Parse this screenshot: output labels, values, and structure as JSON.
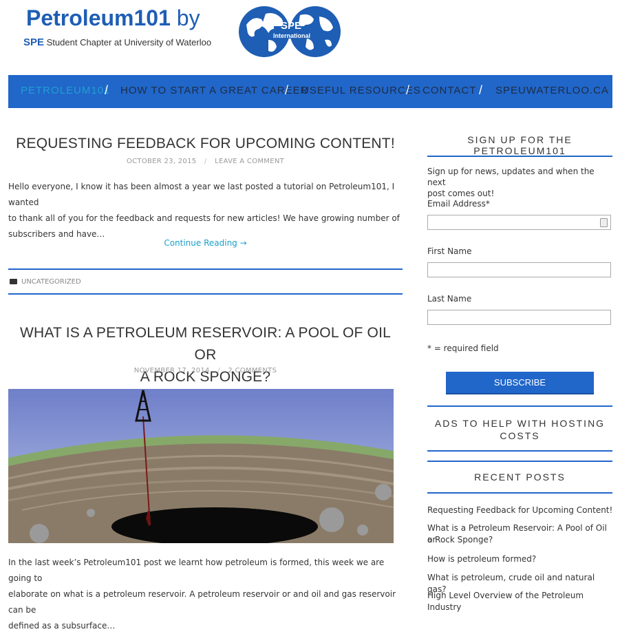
{
  "header": {
    "title": "Petroleum101",
    "title_by": "by",
    "sub_prefix": "SPE",
    "sub_text": "Student Chapter at University of Waterloo",
    "globe_line1": "SPE",
    "globe_line2": "International"
  },
  "nav": {
    "items": [
      "PETROLEUM101",
      "HOW TO START A GREAT CAREER",
      "USEFUL RESOURCES",
      "CONTACT",
      "SPEUWATERLOO.CA"
    ],
    "separator": "/"
  },
  "posts": [
    {
      "title": "REQUESTING FEEDBACK FOR UPCOMING CONTENT!",
      "date": "OCTOBER 23, 2015",
      "meta_sep": "/",
      "comments": "LEAVE A COMMENT",
      "excerpt_lines": [
        "Hello everyone, I know it has been almost a year we last posted a tutorial on Petroleum101, I wanted",
        "to thank all of you for the feedback and requests for new articles!  We have growing number of",
        "subscribers and have…"
      ],
      "more": "Continue Reading →",
      "category": "UNCATEGORIZED"
    },
    {
      "title_lines": [
        "WHAT IS A PETROLEUM RESERVOIR: A POOL OF OIL OR",
        "A ROCK SPONGE?"
      ],
      "date": "NOVEMBER 17, 2014",
      "meta_sep": "/",
      "comments": "2 COMMENTS",
      "excerpt_lines": [
        "In the last week’s Petroleum101 post we learnt how petroleum is formed, this week we are going to",
        "elaborate on what is a petroleum reservoir. A petroleum reservoir or and oil and gas reservoir can be",
        "defined as a subsurface…"
      ]
    }
  ],
  "sidebar": {
    "signup_heading": "SIGN UP FOR THE PETROLEUM101",
    "signup_text_lines": [
      "Sign up for news, updates and when the next",
      "post comes out!"
    ],
    "email_label": "Email Address*",
    "first_name_label": "First Name",
    "last_name_label": "Last Name",
    "required_note": "* = required field",
    "subscribe_label": "SUBSCRIBE",
    "ads_heading_lines": [
      "ADS TO HELP WITH HOSTING",
      "COSTS"
    ],
    "recent_heading": "RECENT POSTS",
    "recent_posts": [
      "Requesting Feedback for Upcoming Content!",
      "What is a Petroleum Reservoir: A Pool of Oil or",
      "a Rock Sponge?",
      "How is petroleum formed?",
      "What is petroleum, crude oil and natural gas?",
      "High Level Overview of the Petroleum Industry"
    ]
  },
  "colors": {
    "brand_blue": "#2166c9",
    "nav_active": "#1ea0d0",
    "link_teal": "#1aa0c8"
  }
}
